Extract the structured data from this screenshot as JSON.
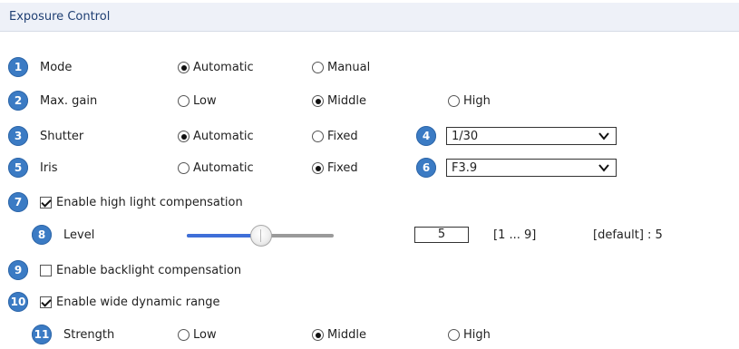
{
  "section_title": "Exposure Control",
  "mode": {
    "badge": "1",
    "label": "Mode",
    "options": [
      "Automatic",
      "Manual"
    ],
    "selected": "Automatic"
  },
  "max_gain": {
    "badge": "2",
    "label": "Max. gain",
    "options": [
      "Low",
      "Middle",
      "High"
    ],
    "selected": "Middle"
  },
  "shutter": {
    "badge": "3",
    "label": "Shutter",
    "options": [
      "Automatic",
      "Fixed"
    ],
    "selected": "Automatic",
    "select_badge": "4",
    "select_value": "1/30"
  },
  "iris": {
    "badge": "5",
    "label": "Iris",
    "options": [
      "Automatic",
      "Fixed"
    ],
    "selected": "Fixed",
    "select_badge": "6",
    "select_value": "F3.9"
  },
  "high_light": {
    "badge": "7",
    "label": "Enable high light compensation",
    "checked": true
  },
  "level": {
    "badge": "8",
    "label": "Level",
    "value": "5",
    "range": "[1 ... 9]",
    "default": "[default] : 5"
  },
  "backlight": {
    "badge": "9",
    "label": "Enable backlight compensation",
    "checked": false
  },
  "wdr": {
    "badge": "10",
    "label": "Enable wide dynamic range",
    "checked": true
  },
  "strength": {
    "badge": "11",
    "label": "Strength",
    "options": [
      "Low",
      "Middle",
      "High"
    ],
    "selected": "Middle"
  },
  "colors": {
    "badge": "#3b7bc4",
    "slider_fill": "#3f6fd8",
    "slider_track": "#9a9a9a",
    "header_bg": "#eef1f8",
    "header_text": "#1f3f73"
  }
}
